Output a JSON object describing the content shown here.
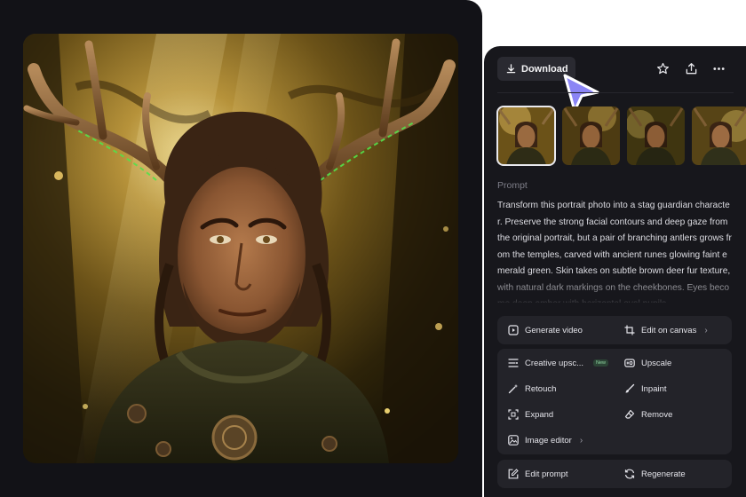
{
  "toolbar": {
    "download_label": "Download",
    "icons": [
      "download-icon",
      "star-icon",
      "share-icon",
      "more-icon"
    ]
  },
  "thumbnails": {
    "count": 4,
    "selected_index": 0
  },
  "prompt": {
    "label": "Prompt",
    "text": "Transform this portrait photo into a stag guardian character. Preserve the strong facial contours and deep gaze from the original portrait, but a pair of branching antlers grows from the temples, carved with ancient runes glowing faint emerald green. Skin takes on subtle brown deer fur texture, with natural dark markings on the cheekbones. Eyes become deep amber with horizontal oval pupils."
  },
  "actions": {
    "generate_video": "Generate video",
    "edit_on_canvas": "Edit on canvas",
    "creative_upscale": "Creative upsc...",
    "new_badge": "New",
    "upscale": "Upscale",
    "retouch": "Retouch",
    "inpaint": "Inpaint",
    "expand": "Expand",
    "remove": "Remove",
    "image_editor": "Image editor",
    "edit_prompt": "Edit prompt",
    "regenerate": "Regenerate",
    "chevron": "›"
  },
  "colors": {
    "panel_bg": "#17171c",
    "card_bg": "#121217",
    "group_bg": "#232329",
    "cursor": "#8b85f5",
    "rune_glow": "#54e04a"
  }
}
